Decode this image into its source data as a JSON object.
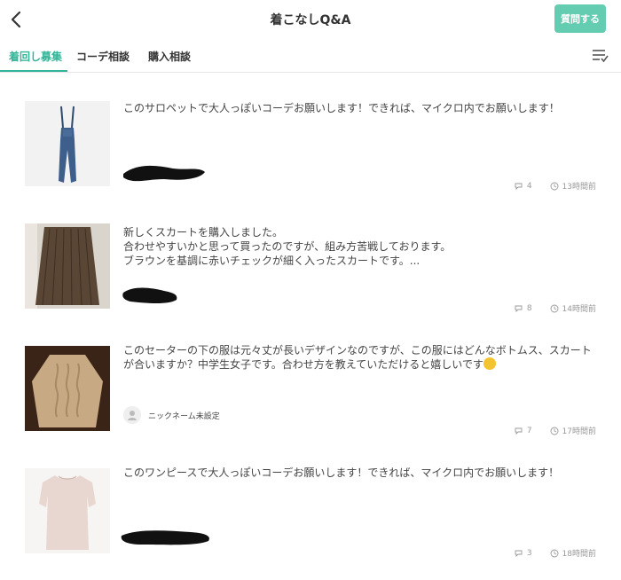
{
  "header": {
    "title": "着こなしQ&A",
    "ask_label": "質問する"
  },
  "tabs": [
    {
      "label": "着回し募集",
      "active": true
    },
    {
      "label": "コーデ相談",
      "active": false
    },
    {
      "label": "購入相談",
      "active": false
    }
  ],
  "colors": {
    "accent": "#31b497",
    "button": "#64cdb1"
  },
  "posts": [
    {
      "text": "このサロペットで大人っぽいコーデお願いします！できれば、マイクロ内でお願いします！",
      "comments": "4",
      "time": "13時間前",
      "image": "denim-overalls"
    },
    {
      "text_lines": [
        "新しくスカートを購入しました。",
        "合わせやすいかと思って買ったのですが、組み方苦戦しております。",
        "ブラウンを基調に赤いチェックが細く入ったスカートです。..."
      ],
      "comments": "8",
      "time": "14時間前",
      "image": "pleated-brown-skirt"
    },
    {
      "text_lines": [
        "このセーターの下の服は元々丈が長いデザインなのですが、この服にはどんなボトムス、スカート",
        "が合いますか？中学生女子です。合わせ方を教えていただけると嬉しいです"
      ],
      "author": "ニックネーム未設定",
      "comments": "7",
      "time": "17時間前",
      "image": "beige-cable-sweater"
    },
    {
      "text": "このワンピースで大人っぽいコーデお願いします！できれば、マイクロ内でお願いします！",
      "comments": "3",
      "time": "18時間前",
      "image": "pink-knit-dress"
    }
  ]
}
